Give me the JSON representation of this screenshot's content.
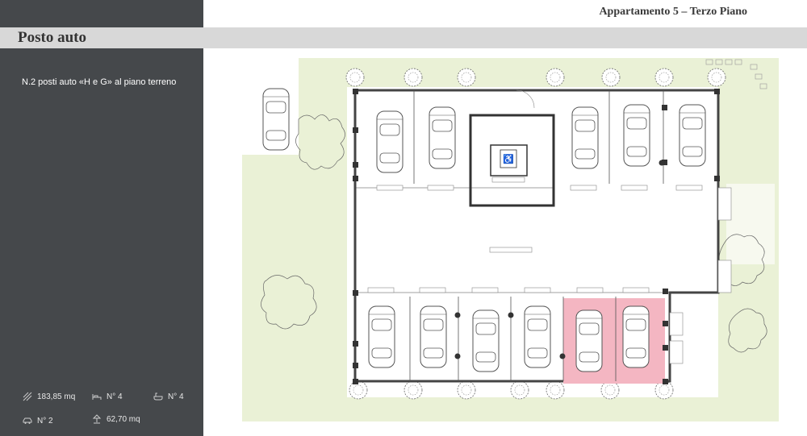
{
  "header": {
    "title": "Appartamento 5 – Terzo Piano"
  },
  "section": {
    "title": "Posto auto"
  },
  "description": "N.2 posti auto «H e G» al piano terreno",
  "stats": [
    {
      "icon": "area-icon",
      "value": "183,85 mq"
    },
    {
      "icon": "bed-icon",
      "value": "N° 4"
    },
    {
      "icon": "bathtub-icon",
      "value": "N° 4"
    },
    {
      "icon": "car-icon",
      "value": "N° 2"
    },
    {
      "icon": "terrace-icon",
      "value": "62,70 mq"
    }
  ],
  "colors": {
    "sidebar": "#45484b",
    "highlight": "#f4b6c2",
    "greenery": "#e8f0d4"
  }
}
